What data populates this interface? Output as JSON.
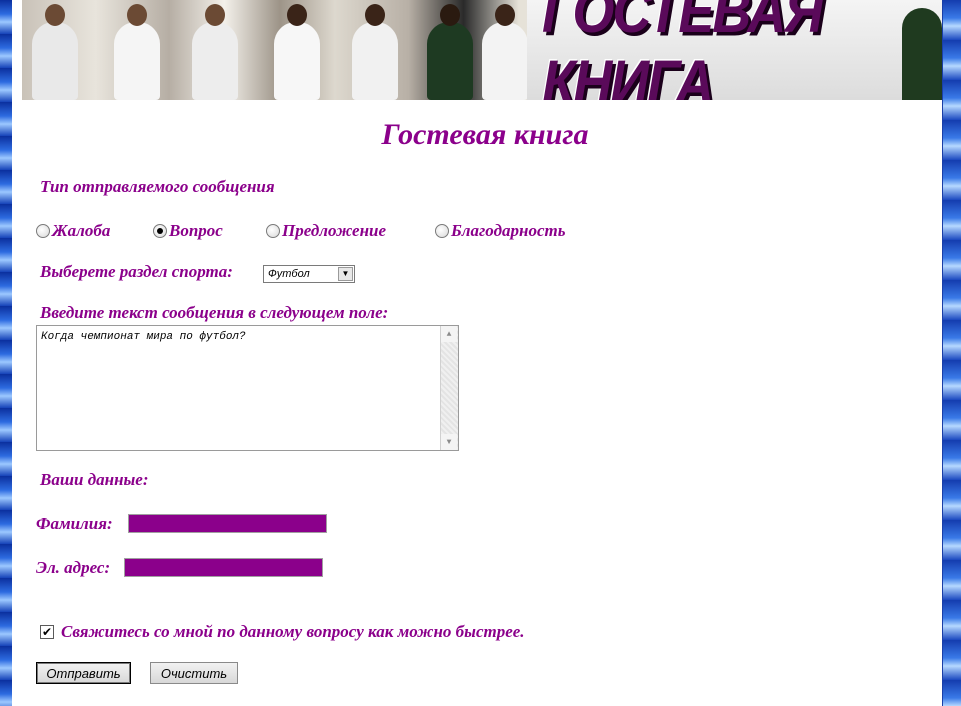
{
  "banner": {
    "title": "ГОСТЕВАЯ КНИГА"
  },
  "page": {
    "heading": "Гостевая книга"
  },
  "message_type": {
    "label": "Тип отправляемого сообщения",
    "options": [
      {
        "label": "Жалоба",
        "selected": false
      },
      {
        "label": "Вопрос",
        "selected": true
      },
      {
        "label": "Предложение",
        "selected": false
      },
      {
        "label": "Благодарность",
        "selected": false
      }
    ]
  },
  "sport": {
    "label": "Выберете раздел спорта:",
    "selected": "Футбол"
  },
  "message": {
    "label": "Введите текст сообщения в следующем поле:",
    "value": "Когда чемпионат мира по футбол?"
  },
  "user_data": {
    "label": "Ваши данные:",
    "surname_label": "Фамилия:",
    "surname_value": "",
    "email_label": "Эл. адрес:",
    "email_value": ""
  },
  "contact": {
    "checked": true,
    "label": "Свяжитесь со мной по данному вопросу как можно быстрее."
  },
  "buttons": {
    "submit": "Отправить",
    "clear": "Очистить"
  },
  "colors": {
    "accent": "#8b008b",
    "background": "#1a3fa8"
  }
}
